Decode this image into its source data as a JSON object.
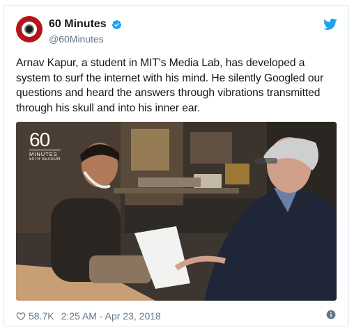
{
  "account": {
    "name": "60 Minutes",
    "handle": "@60Minutes",
    "verified": true,
    "avatar_icon": "60-minutes-stopwatch-logo"
  },
  "tweet": {
    "text": "Arnav Kapur, a student in MIT's Media Lab, has developed a system to surf the internet with his mind. He silently Googled our questions and heard the answers through vibrations transmitted through his skull and into his inner ear."
  },
  "media": {
    "logo_number": "60",
    "logo_word": "MINUTES",
    "logo_season": "50TH SEASON"
  },
  "footer": {
    "likes": "58.7K",
    "timestamp": "2:25 AM - Apr 23, 2018",
    "like_icon": "heart-icon",
    "info_icon": "info-icon"
  },
  "colors": {
    "brand_blue": "#1da1f2",
    "text": "#14171a",
    "muted": "#657786",
    "border": "#e1e8ed"
  }
}
